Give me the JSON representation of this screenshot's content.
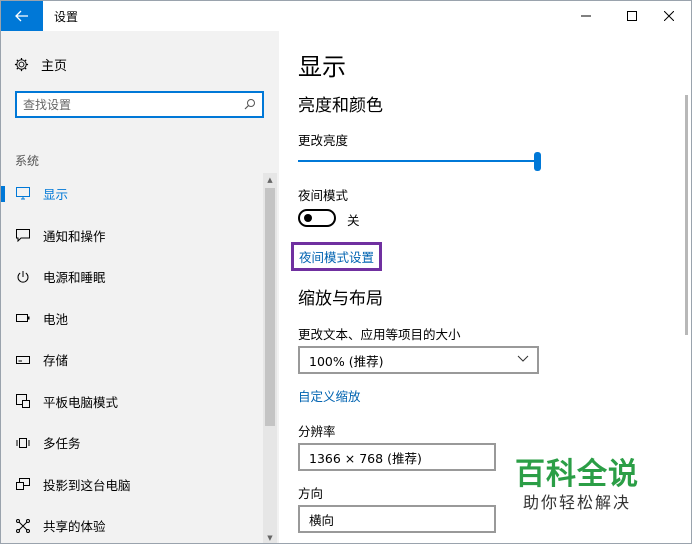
{
  "window": {
    "title": "设置"
  },
  "sidebar": {
    "home_label": "主页",
    "search_placeholder": "查找设置",
    "section_label": "系统",
    "items": [
      {
        "label": "显示",
        "icon": "monitor-icon",
        "active": true
      },
      {
        "label": "通知和操作",
        "icon": "message-icon"
      },
      {
        "label": "电源和睡眠",
        "icon": "power-icon"
      },
      {
        "label": "电池",
        "icon": "battery-icon"
      },
      {
        "label": "存储",
        "icon": "storage-icon"
      },
      {
        "label": "平板电脑模式",
        "icon": "tablet-mode-icon"
      },
      {
        "label": "多任务",
        "icon": "multitask-icon"
      },
      {
        "label": "投影到这台电脑",
        "icon": "project-icon"
      },
      {
        "label": "共享的体验",
        "icon": "shared-experience-icon"
      }
    ]
  },
  "main": {
    "title": "显示",
    "brightness_section": "亮度和颜色",
    "brightness_label": "更改亮度",
    "brightness_level_percent": 100,
    "night_mode_label": "夜间模式",
    "night_mode_state": "关",
    "night_mode_link": "夜间模式设置",
    "scale_section": "缩放与布局",
    "scale_label": "更改文本、应用等项目的大小",
    "scale_value": "100% (推荐)",
    "custom_scale_link": "自定义缩放",
    "resolution_label": "分辨率",
    "resolution_value": "1366 × 768 (推荐)",
    "orientation_label": "方向",
    "orientation_value": "横向"
  },
  "watermark": {
    "logo": "百科全说",
    "subtitle": "助你轻松解决"
  },
  "colors": {
    "accent": "#0078d7",
    "link": "#0063b1",
    "highlight_box": "#7030a0",
    "watermark_green": "#2b9e46"
  }
}
